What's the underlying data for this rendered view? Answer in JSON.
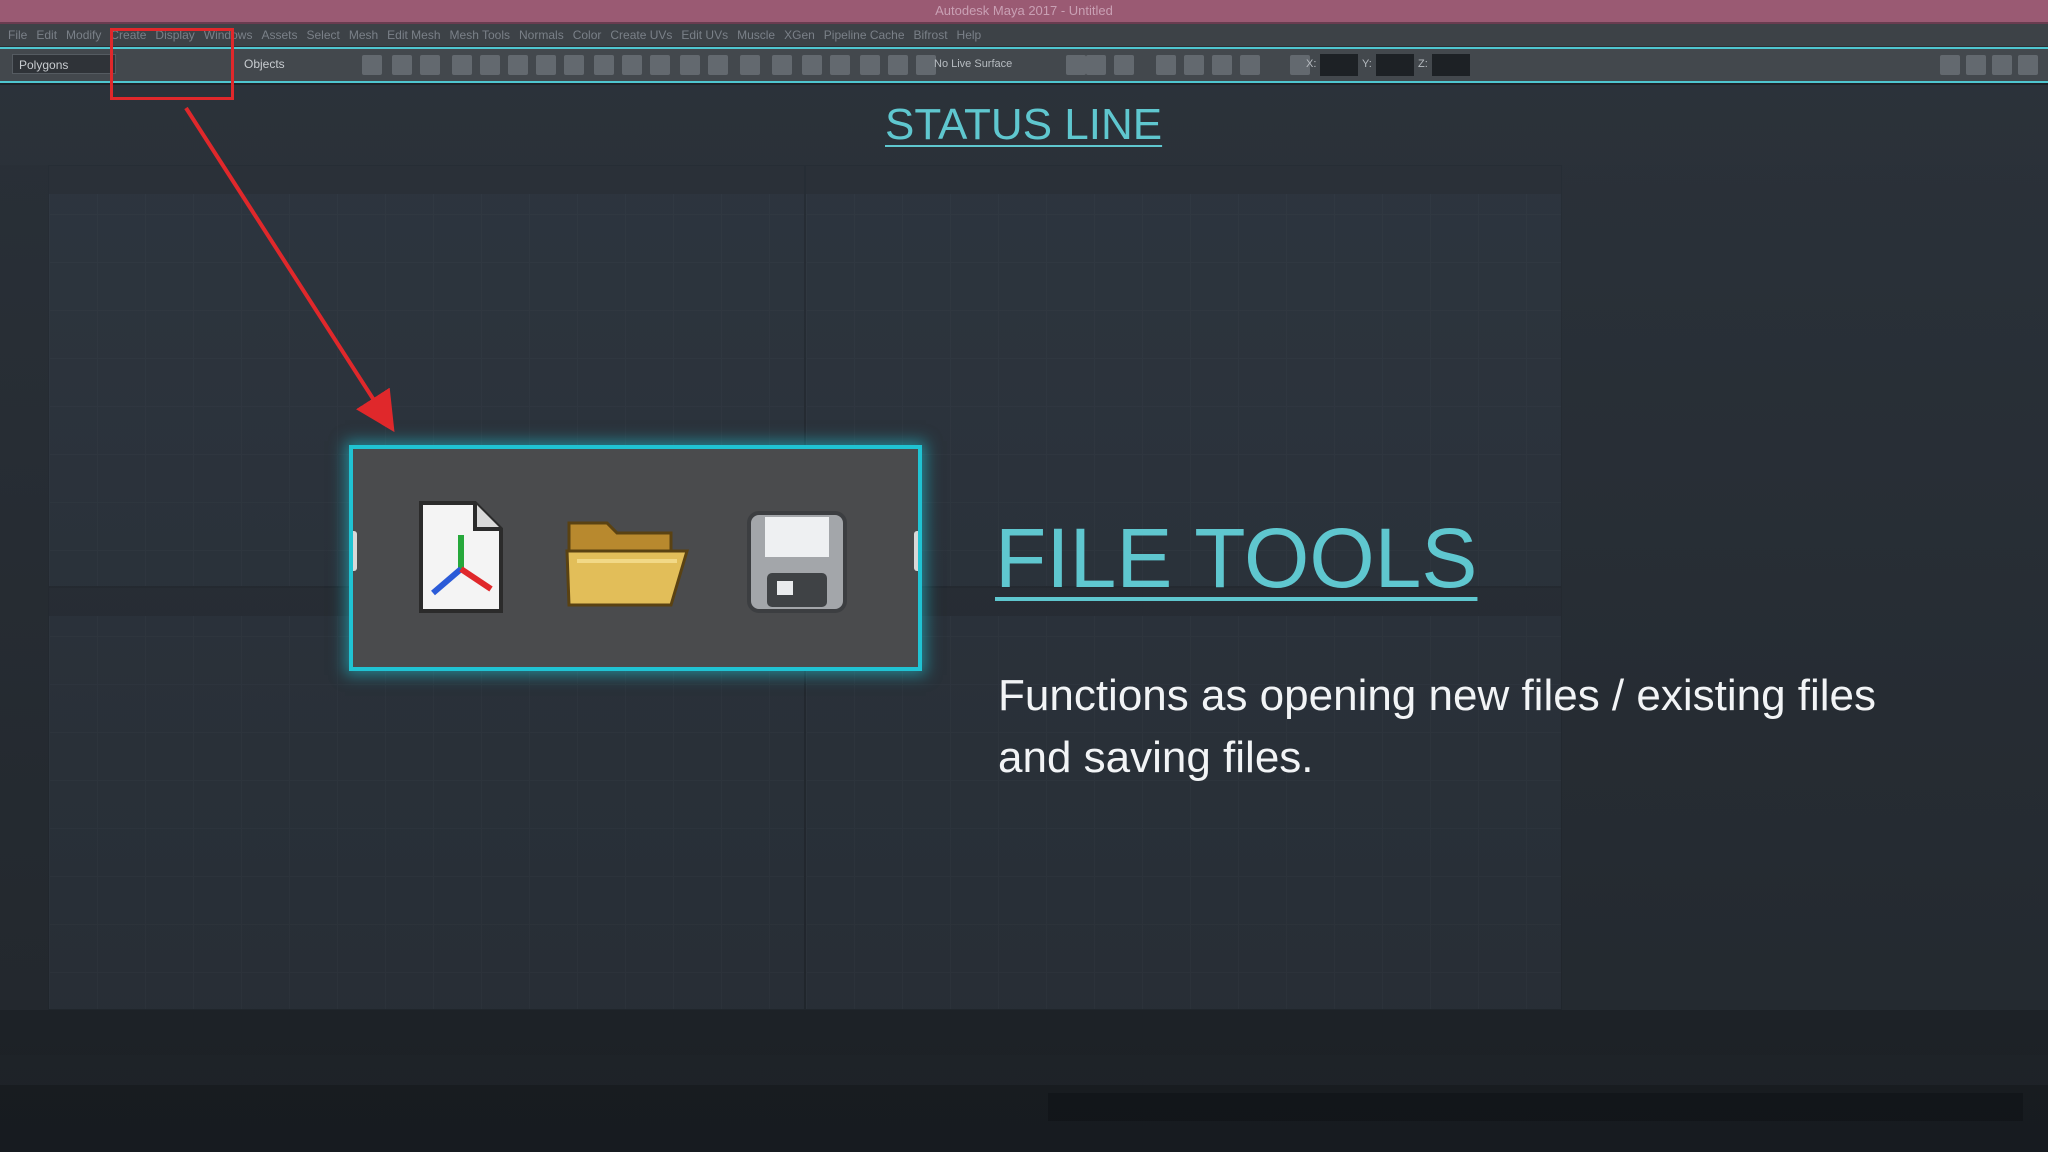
{
  "window": {
    "title": "Autodesk Maya 2017 - Untitled"
  },
  "menubar": {
    "items": [
      "File",
      "Edit",
      "Modify",
      "Create",
      "Display",
      "Windows",
      "Assets",
      "Select",
      "Mesh",
      "Edit Mesh",
      "Mesh Tools",
      "Normals",
      "Color",
      "Create UVs",
      "Edit UVs",
      "Muscle",
      "XGen",
      "Pipeline Cache",
      "Bifrost",
      "Help"
    ]
  },
  "status_line": {
    "menuset": "Polygons",
    "selection_mode": "Objects",
    "live_surface": "No Live Surface",
    "xyz": [
      "X:",
      "Y:",
      "Z:"
    ]
  },
  "annotations": {
    "status_line_title": "STATUS LINE",
    "file_tools_title": "FILE TOOLS",
    "description": "Functions as opening new files / existing files and saving files."
  },
  "file_tools": {
    "icons": [
      "new-scene-icon",
      "open-scene-icon",
      "save-scene-icon"
    ]
  },
  "colors": {
    "accent": "#5fc7cf",
    "highlight_border": "#20c3d3",
    "callout_red": "#e0282b"
  }
}
